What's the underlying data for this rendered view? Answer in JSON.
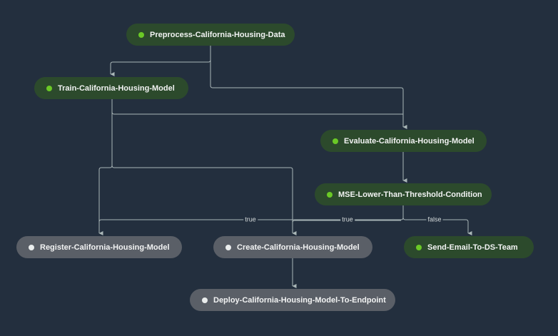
{
  "pipeline": {
    "colors": {
      "background": "#232f3e",
      "succeeded_node": "#2c4a2c",
      "succeeded_dot": "#6bc926",
      "not_started_node": "#5a5f67",
      "not_started_dot": "#eaeded",
      "edge": "#aab7b8"
    },
    "nodes": [
      {
        "id": "preprocess",
        "label": "Preprocess-California-Housing-Data",
        "status": "success"
      },
      {
        "id": "train",
        "label": "Train-California-Housing-Model",
        "status": "success"
      },
      {
        "id": "evaluate",
        "label": "Evaluate-California-Housing-Model",
        "status": "success"
      },
      {
        "id": "condition",
        "label": "MSE-Lower-Than-Threshold-Condition",
        "status": "success"
      },
      {
        "id": "register",
        "label": "Register-California-Housing-Model",
        "status": "pending"
      },
      {
        "id": "create",
        "label": "Create-California-Housing-Model",
        "status": "pending"
      },
      {
        "id": "email",
        "label": "Send-Email-To-DS-Team",
        "status": "success"
      },
      {
        "id": "deploy",
        "label": "Deploy-California-Housing-Model-To-Endpoint",
        "status": "pending"
      }
    ],
    "edge_labels": {
      "to_register": "true",
      "to_create": "true",
      "to_email": "false"
    }
  }
}
